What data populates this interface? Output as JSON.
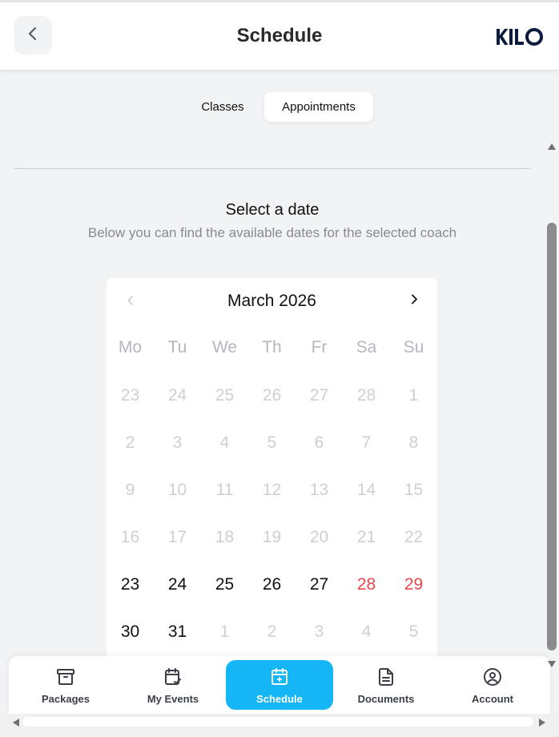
{
  "header": {
    "title": "Schedule",
    "back_icon": "chevron-left-icon",
    "logo_text": "KILO"
  },
  "tabs": [
    {
      "label": "Classes",
      "active": false
    },
    {
      "label": "Appointments",
      "active": true
    }
  ],
  "intro": {
    "title": "Select a date",
    "subtitle": "Below you can find the available dates for the selected coach"
  },
  "calendar": {
    "month_label": "March 2026",
    "weekdays": [
      "Mo",
      "Tu",
      "We",
      "Th",
      "Fr",
      "Sa",
      "Su"
    ],
    "weeks": [
      [
        {
          "d": "23",
          "s": "muted"
        },
        {
          "d": "24",
          "s": "muted"
        },
        {
          "d": "25",
          "s": "muted"
        },
        {
          "d": "26",
          "s": "muted"
        },
        {
          "d": "27",
          "s": "muted"
        },
        {
          "d": "28",
          "s": "muted"
        },
        {
          "d": "1",
          "s": "muted"
        }
      ],
      [
        {
          "d": "2",
          "s": "muted"
        },
        {
          "d": "3",
          "s": "muted"
        },
        {
          "d": "4",
          "s": "muted"
        },
        {
          "d": "5",
          "s": "muted"
        },
        {
          "d": "6",
          "s": "muted"
        },
        {
          "d": "7",
          "s": "muted"
        },
        {
          "d": "8",
          "s": "muted"
        }
      ],
      [
        {
          "d": "9",
          "s": "muted"
        },
        {
          "d": "10",
          "s": "muted"
        },
        {
          "d": "11",
          "s": "muted"
        },
        {
          "d": "12",
          "s": "muted"
        },
        {
          "d": "13",
          "s": "muted"
        },
        {
          "d": "14",
          "s": "muted"
        },
        {
          "d": "15",
          "s": "muted"
        }
      ],
      [
        {
          "d": "16",
          "s": "muted"
        },
        {
          "d": "17",
          "s": "muted"
        },
        {
          "d": "18",
          "s": "muted"
        },
        {
          "d": "19",
          "s": "muted"
        },
        {
          "d": "20",
          "s": "muted"
        },
        {
          "d": "21",
          "s": "muted"
        },
        {
          "d": "22",
          "s": "muted"
        }
      ],
      [
        {
          "d": "23",
          "s": "avail"
        },
        {
          "d": "24",
          "s": "avail"
        },
        {
          "d": "25",
          "s": "avail"
        },
        {
          "d": "26",
          "s": "avail"
        },
        {
          "d": "27",
          "s": "avail"
        },
        {
          "d": "28",
          "s": "weekend"
        },
        {
          "d": "29",
          "s": "weekend"
        }
      ],
      [
        {
          "d": "30",
          "s": "avail"
        },
        {
          "d": "31",
          "s": "avail"
        },
        {
          "d": "1",
          "s": "muted"
        },
        {
          "d": "2",
          "s": "muted"
        },
        {
          "d": "3",
          "s": "muted"
        },
        {
          "d": "4",
          "s": "muted"
        },
        {
          "d": "5",
          "s": "muted"
        }
      ]
    ]
  },
  "bottom_nav": [
    {
      "label": "Packages",
      "icon": "archive-box-icon",
      "active": false
    },
    {
      "label": "My Events",
      "icon": "calendar-check-icon",
      "active": false
    },
    {
      "label": "Schedule",
      "icon": "calendar-icon",
      "active": true
    },
    {
      "label": "Documents",
      "icon": "document-icon",
      "active": false
    },
    {
      "label": "Account",
      "icon": "user-circle-icon",
      "active": false
    }
  ],
  "colors": {
    "accent": "#14b6f5",
    "weekend": "#e5484d",
    "muted_day": "#ccd0d5",
    "background": "#f2f3f5"
  }
}
